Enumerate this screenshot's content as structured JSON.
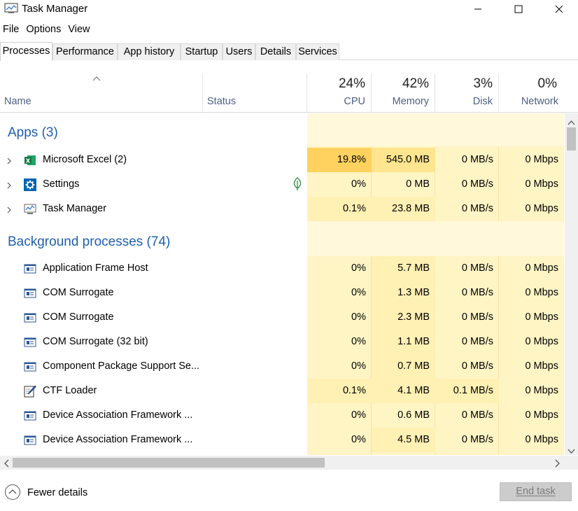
{
  "window": {
    "title": "Task Manager"
  },
  "menu": [
    "File",
    "Options",
    "View"
  ],
  "tabs": [
    "Processes",
    "Performance",
    "App history",
    "Startup",
    "Users",
    "Details",
    "Services"
  ],
  "columns": {
    "name": "Name",
    "status": "Status",
    "cpu": {
      "percent": "24%",
      "label": "CPU"
    },
    "memory": {
      "percent": "42%",
      "label": "Memory"
    },
    "disk": {
      "percent": "3%",
      "label": "Disk"
    },
    "network": {
      "percent": "0%",
      "label": "Network"
    }
  },
  "groups": {
    "apps": "Apps (3)",
    "background": "Background processes (74)"
  },
  "apps": [
    {
      "name": "Microsoft Excel (2)",
      "icon": "excel-icon",
      "cpu": "19.8%",
      "memory": "545.0 MB",
      "disk": "0 MB/s",
      "network": "0 Mbps"
    },
    {
      "name": "Settings",
      "icon": "settings-gear-icon",
      "cpu": "0%",
      "memory": "0 MB",
      "disk": "0 MB/s",
      "network": "0 Mbps"
    },
    {
      "name": "Task Manager",
      "icon": "task-manager-icon",
      "cpu": "0.1%",
      "memory": "23.8 MB",
      "disk": "0 MB/s",
      "network": "0 Mbps"
    }
  ],
  "background": [
    {
      "name": "Application Frame Host",
      "cpu": "0%",
      "memory": "5.7 MB",
      "disk": "0 MB/s",
      "network": "0 Mbps"
    },
    {
      "name": "COM Surrogate",
      "cpu": "0%",
      "memory": "1.3 MB",
      "disk": "0 MB/s",
      "network": "0 Mbps"
    },
    {
      "name": "COM Surrogate",
      "cpu": "0%",
      "memory": "2.3 MB",
      "disk": "0 MB/s",
      "network": "0 Mbps"
    },
    {
      "name": "COM Surrogate (32 bit)",
      "cpu": "0%",
      "memory": "1.1 MB",
      "disk": "0 MB/s",
      "network": "0 Mbps"
    },
    {
      "name": "Component Package Support Se...",
      "cpu": "0%",
      "memory": "0.7 MB",
      "disk": "0 MB/s",
      "network": "0 Mbps"
    },
    {
      "name": "CTF Loader",
      "cpu": "0.1%",
      "memory": "4.1 MB",
      "disk": "0.1 MB/s",
      "network": "0 Mbps"
    },
    {
      "name": "Device Association Framework ...",
      "cpu": "0%",
      "memory": "0.6 MB",
      "disk": "0 MB/s",
      "network": "0 Mbps"
    },
    {
      "name": "Device Association Framework ...",
      "cpu": "0%",
      "memory": "4.5 MB",
      "disk": "0 MB/s",
      "network": "0 Mbps"
    }
  ],
  "footer": {
    "fewer_details": "Fewer details",
    "end_task": "End task"
  },
  "colors": {
    "group_title": "#1f5fad",
    "heat_light": "#fff4c4",
    "heat_medium": "#fff0b3",
    "heat_high": "#ffd25f",
    "heat_excel_mem": "#ffe58f"
  }
}
